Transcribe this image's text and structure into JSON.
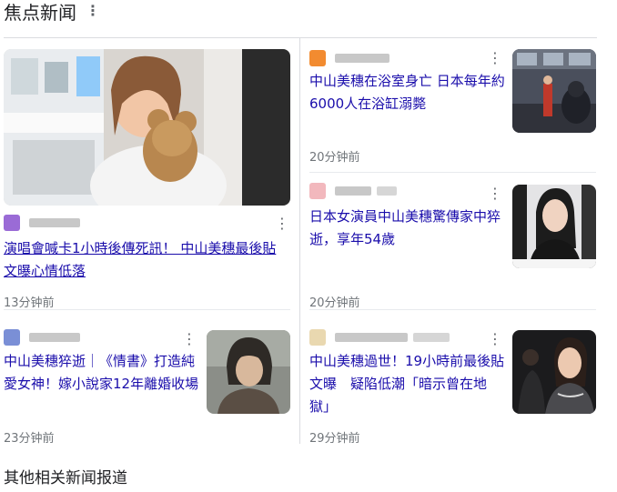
{
  "header": {
    "title": "焦点新闻"
  },
  "cards": [
    {
      "headline": "演唱會喊卡1小時後傳死訊！ 中山美穗最後貼文曝心情低落",
      "time": "13分钟前"
    },
    {
      "headline": "中山美穗在浴室身亡 日本每年約6000人在浴缸溺斃",
      "time": "20分钟前"
    },
    {
      "headline": "日本女演員中山美穗驚傳家中猝逝，享年54歲",
      "time": "20分钟前"
    },
    {
      "headline": "中山美穗猝逝｜《情書》打造純愛女神！嫁小說家12年離婚收場",
      "time": "23分钟前"
    },
    {
      "headline": "中山美穗過世！19小時前最後貼文曝　疑陷低潮「暗示曾在地獄」",
      "time": "29分钟前"
    }
  ],
  "footer": {
    "title": "其他相关新闻报道"
  },
  "colors": {
    "link": "#1a0dab",
    "meta": "#70757a",
    "divider": "#dadce0",
    "logo_orange": "#f28b30",
    "logo_purple": "#9a6bd6"
  },
  "icons": {
    "more": "more-vert-icon"
  }
}
